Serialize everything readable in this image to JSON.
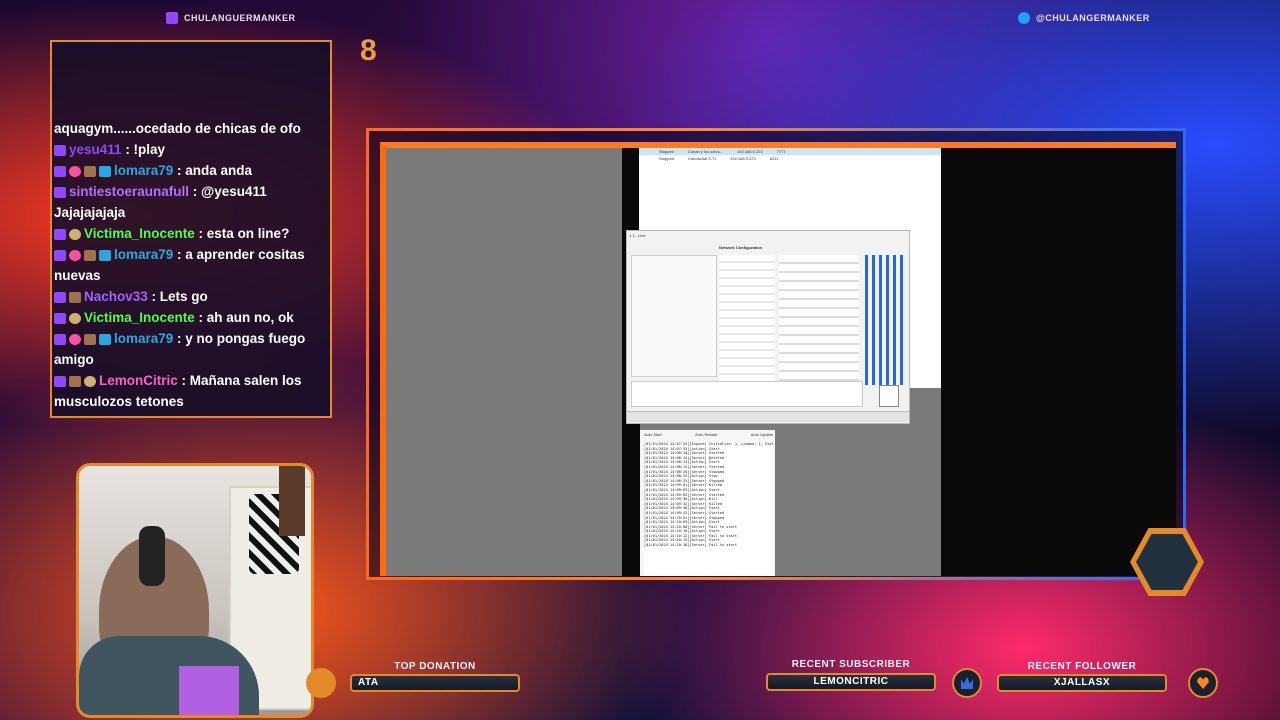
{
  "header": {
    "twitch_handle": "CHULANGUERMANKER",
    "twitter_handle": "@CHULANGERMANKER"
  },
  "counter": "8",
  "chat": {
    "messages": [
      {
        "user": "aquagym...",
        "text": "...ocedado de chicas de ofo",
        "color": "#ffffff",
        "partial": true
      },
      {
        "user": "yesu411",
        "text": " : !play",
        "color": "#9146ff",
        "badges": [
          "sub"
        ]
      },
      {
        "user": "lomara79",
        "text": " : anda anda",
        "color": "#29a8e0",
        "badges": [
          "sub",
          "heart",
          "bit",
          "crown"
        ]
      },
      {
        "user": "sintiestoeraunafull",
        "text": " : @yesu411 Jajajajajaja",
        "color": "#b070ff",
        "badges": [
          "sub"
        ]
      },
      {
        "user": "Victima_Inocente",
        "text": " : esta on line?",
        "color": "#4cff4c",
        "badges": [
          "sub",
          "skull"
        ]
      },
      {
        "user": "lomara79",
        "text": " : a aprender cositas nuevas",
        "color": "#29a8e0",
        "badges": [
          "sub",
          "heart",
          "bit",
          "crown"
        ]
      },
      {
        "user": "Nachov33",
        "text": " : Lets go",
        "color": "#a060ff",
        "badges": [
          "sub",
          "bit"
        ]
      },
      {
        "user": "Victima_Inocente",
        "text": " : ah aun no, ok",
        "color": "#4cff4c",
        "badges": [
          "sub",
          "skull"
        ]
      },
      {
        "user": "lomara79",
        "text": " : y no pongas fuego amigo",
        "color": "#29a8e0",
        "badges": [
          "sub",
          "heart",
          "bit",
          "crown"
        ]
      },
      {
        "user": "LemonCitric",
        "text": " : Mañana salen los musculozos tetones",
        "color": "#ff60c0",
        "badges": [
          "sub",
          "bit",
          "skull"
        ]
      }
    ]
  },
  "stream_screen": {
    "server_list": [
      {
        "status": "Stopped",
        "name": "Conan y los sotos...",
        "ip": "192.168.0.223",
        "port": "7777"
      },
      {
        "status": "Stopped",
        "name": "Curiosidad S.T.I",
        "ip": "192.168.0.223",
        "port": "8211"
      }
    ],
    "dialog_title": "1.1 - Live",
    "network_config": "Network Configuration",
    "log_toggles": [
      "Auto Start",
      "Auto Restart",
      "Auto Update"
    ],
    "log_lines": [
      "[01/01/2024 14:07:53][Engine] Initialize: 1, Loaded: 1, Failed: 0",
      "[01/01/2024 14:07:55][Action] Start",
      "[01/01/2024 14:08:10][Server] Started",
      "[01/01/2024 14:08:12][Server] Deleted",
      "[01/01/2024 14:08:14][Action] Start",
      "[01/01/2024 14:08:15][Server] Started",
      "[01/01/2024 14:08:20][Server] Stopped",
      "[01/01/2024 14:08:22][Action] Stop",
      "[01/01/2024 14:08:25][Server] Stopped",
      "[01/01/2024 14:09:01][Server] Killed",
      "[01/01/2024 14:09:03][Action] Start",
      "[01/01/2024 14:09:05][Server] Started",
      "[01/01/2024 14:09:30][Action] Kill",
      "[01/01/2024 14:09:32][Server] Killed",
      "[01/01/2024 14:09:40][Action] Start",
      "[01/01/2024 14:09:42][Server] Started",
      "[01/01/2024 14:10:01][Server] Stopped",
      "[01/01/2024 14:10:05][Action] Start",
      "[01/01/2024 14:10:08][Server] Fail to start",
      "[01/01/2024 14:10:10][Action] Start",
      "[01/01/2024 14:10:12][Server] Fail to start",
      "[01/01/2024 14:10:15][Action] Start",
      "[01/01/2024 14:10:18][Server] Fail to start"
    ]
  },
  "bottom_bar": {
    "top_donation_title": "TOP DONATION",
    "top_donation_value": "ATA",
    "recent_subscriber_title": "RECENT SUBSCRIBER",
    "recent_subscriber_value": "LEMONCITRIC",
    "recent_follower_title": "RECENT FOLLOWER",
    "recent_follower_value": "XJALLASX"
  }
}
